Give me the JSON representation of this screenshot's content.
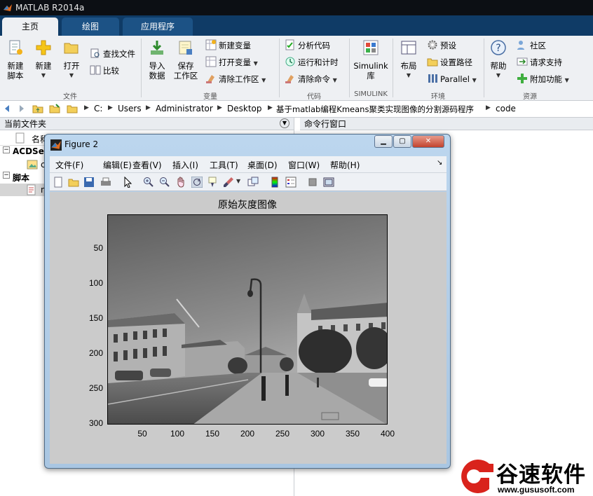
{
  "window": {
    "title": "MATLAB R2014a"
  },
  "tabs": [
    {
      "label": "主页"
    },
    {
      "label": "绘图"
    },
    {
      "label": "应用程序"
    }
  ],
  "ribbon": {
    "file": {
      "new_script": "新建\n脚本",
      "new": "新建",
      "open": "打开",
      "find_files": "查找文件",
      "compare": "比较",
      "group": "文件"
    },
    "variable": {
      "import_data": "导入\n数据",
      "save_workspace": "保存\n工作区",
      "new_variable": "新建变量",
      "open_variable": "打开变量",
      "clear_workspace": "清除工作区",
      "group": "变量"
    },
    "code": {
      "analyze_code": "分析代码",
      "run_and_time": "运行和计时",
      "clear_commands": "清除命令",
      "group": "代码"
    },
    "simulink": {
      "library": "Simulink\n库",
      "group": "SIMULINK"
    },
    "environment": {
      "layout": "布局",
      "preferences": "预设",
      "set_path": "设置路径",
      "parallel": "Parallel",
      "group": "环境"
    },
    "resources": {
      "help": "帮助",
      "community": "社区",
      "request_support": "请求支持",
      "addons": "附加功能",
      "group": "资源"
    }
  },
  "address": {
    "crumbs": [
      "C:",
      "Users",
      "Administrator",
      "Desktop",
      "基于matlab编程Kmeans聚类实现图像的分割源码程序",
      "code"
    ]
  },
  "current_folder": {
    "title": "当前文件夹",
    "name_col": "名称",
    "sections": [
      {
        "label": "ACDSee",
        "file": "c"
      },
      {
        "label": "脚本",
        "file": "n"
      }
    ]
  },
  "command_window": {
    "title": "命令行窗口"
  },
  "figure": {
    "title": "Figure 2",
    "menu": [
      "文件(F)",
      "编辑(E)",
      "查看(V)",
      "插入(I)",
      "工具(T)",
      "桌面(D)",
      "窗口(W)",
      "帮助(H)"
    ],
    "plot_title": "原始灰度图像",
    "y_ticks": [
      "50",
      "100",
      "150",
      "200",
      "250",
      "300"
    ],
    "x_ticks": [
      "50",
      "100",
      "150",
      "200",
      "250",
      "300",
      "350",
      "400"
    ],
    "image_description_icons": [
      "street-photo"
    ]
  },
  "watermark": {
    "brand": "谷速软件",
    "url": "www.gususoft.com",
    "accent": "#d9231c"
  },
  "colors": {
    "tab_bar": "#0f3b66",
    "ribbon": "#eef0f3",
    "figure_frame": "#bcd6ee",
    "canvas": "#cbcbcb"
  }
}
